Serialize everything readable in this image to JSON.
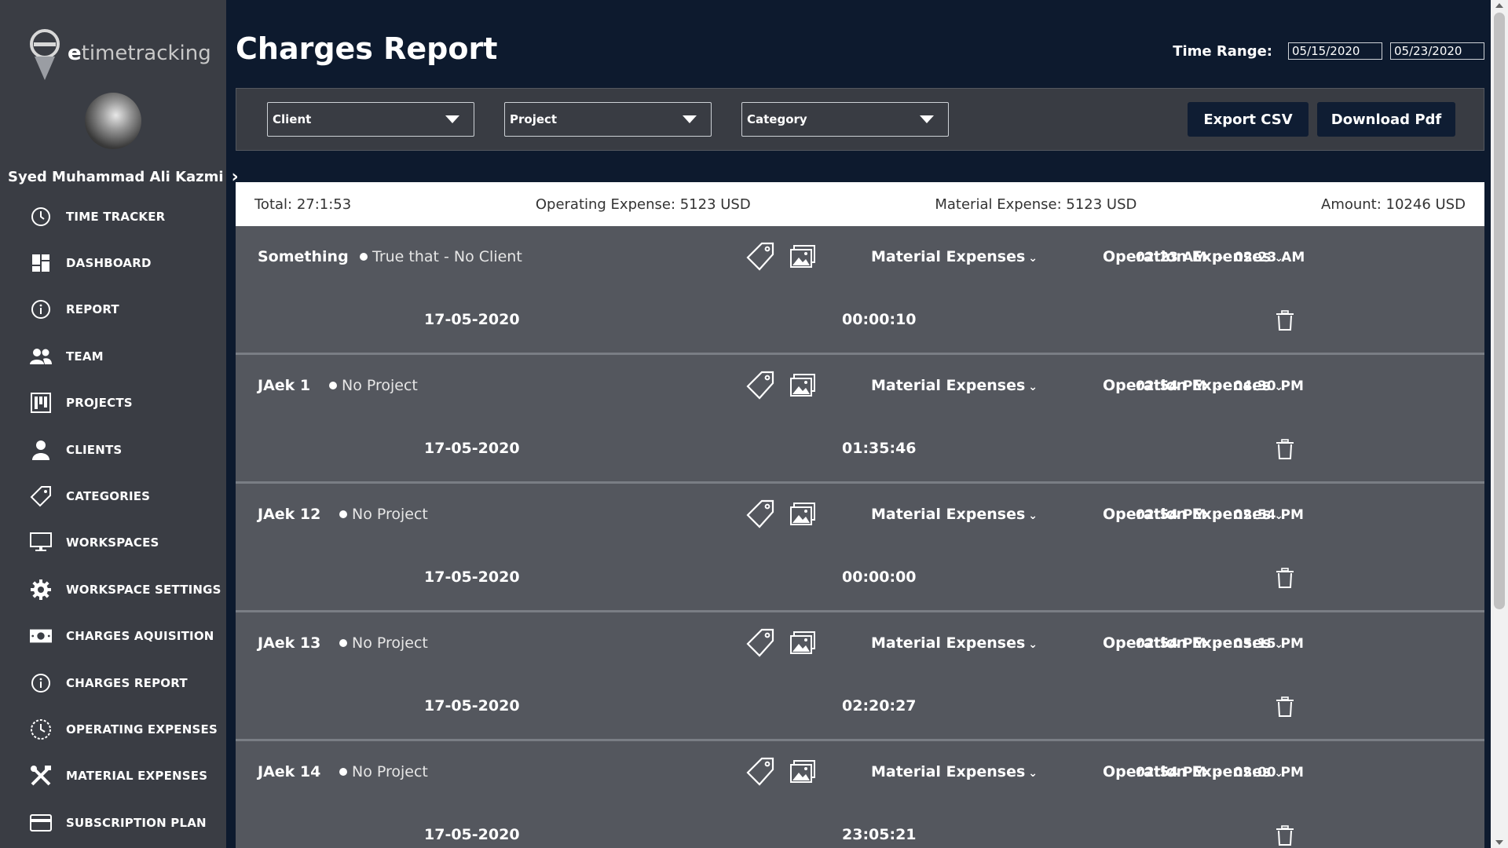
{
  "brand": {
    "prefix": "e",
    "name": "timetracking"
  },
  "user": {
    "name": "Syed Muhammad Ali Kazmi"
  },
  "nav": [
    {
      "label": "TIME TRACKER",
      "icon": "clock-icon"
    },
    {
      "label": "DASHBOARD",
      "icon": "dashboard-icon"
    },
    {
      "label": "REPORT",
      "icon": "info-icon"
    },
    {
      "label": "TEAM",
      "icon": "team-icon"
    },
    {
      "label": "PROJECTS",
      "icon": "projects-icon"
    },
    {
      "label": "CLIENTS",
      "icon": "person-icon"
    },
    {
      "label": "CATEGORIES",
      "icon": "tag-icon"
    },
    {
      "label": "WORKSPACES",
      "icon": "monitor-icon"
    },
    {
      "label": "WORKSPACE SETTINGS",
      "icon": "gear-icon"
    },
    {
      "label": "CHARGES AQUISITION",
      "icon": "money-icon"
    },
    {
      "label": "CHARGES REPORT",
      "icon": "info-icon"
    },
    {
      "label": "OPERATING EXPENSES",
      "icon": "clock-icon"
    },
    {
      "label": "MATERIAL EXPENSES",
      "icon": "tools-icon"
    },
    {
      "label": "SUBSCRIPTION PLAN",
      "icon": "card-icon"
    }
  ],
  "page": {
    "title": "Charges Report",
    "time_range_label": "Time Range:",
    "date_from": "05/15/2020",
    "date_to": "05/23/2020"
  },
  "filters": {
    "client": "Client",
    "project": "Project",
    "category": "Category",
    "export_csv": "Export CSV",
    "download_pdf": "Download Pdf"
  },
  "summary": {
    "total": "Total: 27:1:53",
    "operating": "Operating Expense: 5123 USD",
    "material": "Material Expense: 5123 USD",
    "amount": "Amount: 10246 USD"
  },
  "entries": [
    {
      "name": "Something",
      "project": "True that - No Client",
      "material": "Material Expenses",
      "operation": "Operation Expenses",
      "start": "02:23 AM",
      "end": "02:23 AM",
      "date": "17-05-2020",
      "duration": "00:00:10"
    },
    {
      "name": "JAek 1",
      "project": "No Project",
      "material": "Material Expenses",
      "operation": "Operation Expenses",
      "start": "02:54 PM",
      "end": "04:30 PM",
      "date": "17-05-2020",
      "duration": "01:35:46"
    },
    {
      "name": "JAek 12",
      "project": "No Project",
      "material": "Material Expenses",
      "operation": "Operation Expenses",
      "start": "02:54 PM",
      "end": "02:54 PM",
      "date": "17-05-2020",
      "duration": "00:00:00"
    },
    {
      "name": "JAek 13",
      "project": "No Project",
      "material": "Material Expenses",
      "operation": "Operation Expenses",
      "start": "02:54 PM",
      "end": "05:15 PM",
      "date": "17-05-2020",
      "duration": "02:20:27"
    },
    {
      "name": "JAek 14",
      "project": "No Project",
      "material": "Material Expenses",
      "operation": "Operation Expenses",
      "start": "02:54 PM",
      "end": "02:00 PM",
      "date": "17-05-2020",
      "duration": "23:05:21"
    }
  ],
  "colors": {
    "background": "#0d1a2e",
    "sidebar": "#3a3d44",
    "row": "#54575e",
    "button": "#0f1d33"
  }
}
